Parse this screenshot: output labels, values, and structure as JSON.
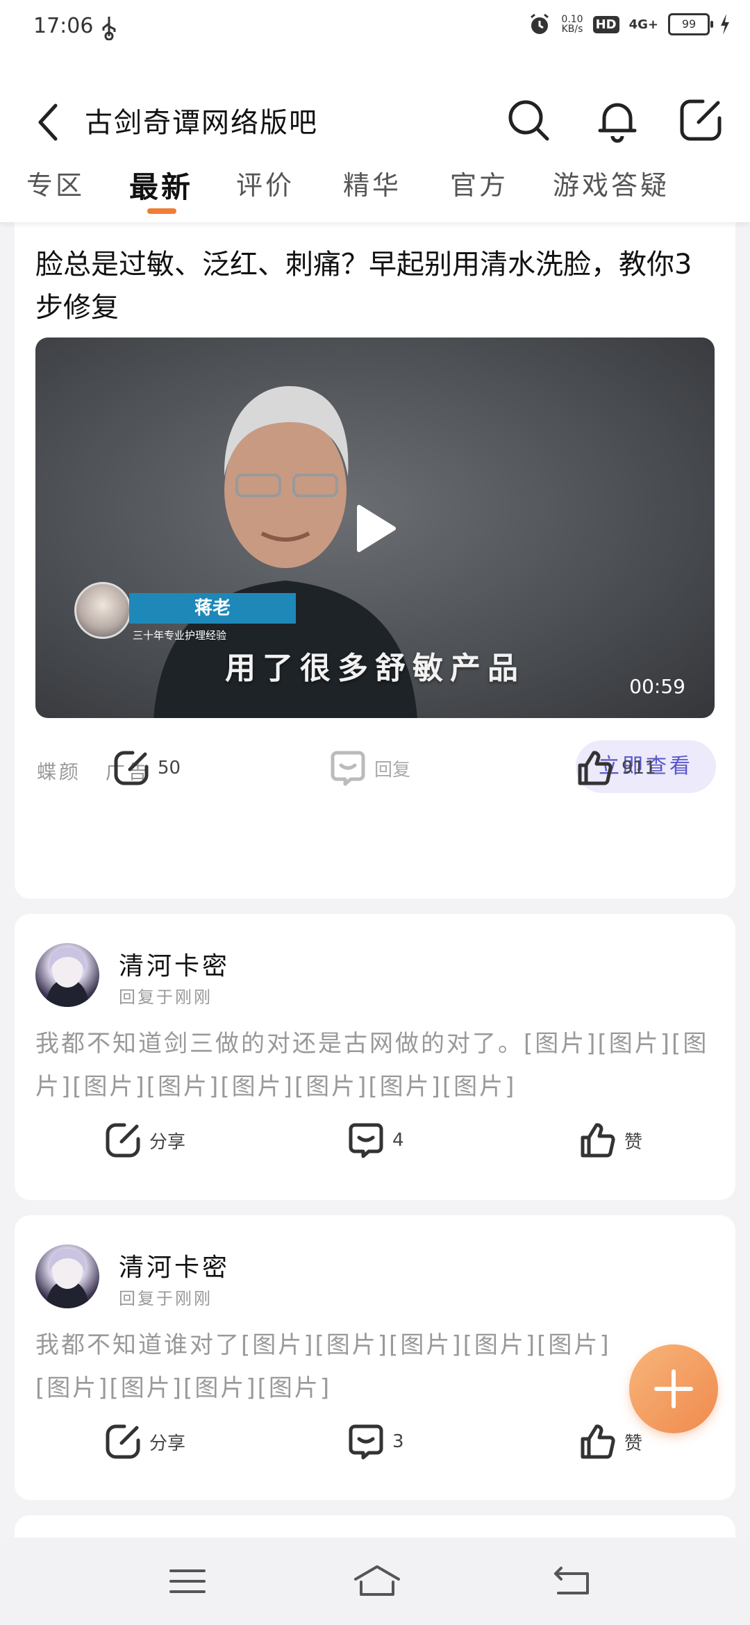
{
  "status_bar": {
    "time": "17:06",
    "network_speed_top": "0.10",
    "network_speed_bottom": "KB/s",
    "hd_badge": "HD",
    "signal": "4G+",
    "battery": "99"
  },
  "header": {
    "title": "古剑奇谭网络版吧",
    "tabs": [
      {
        "label": "专区"
      },
      {
        "label": "最新"
      },
      {
        "label": "评价"
      },
      {
        "label": "精华"
      },
      {
        "label": "官方"
      },
      {
        "label": "游戏答疑"
      }
    ],
    "active_tab": "最新",
    "accent_color": "#f07c35"
  },
  "ad_post": {
    "title": "脸总是过敏、泛红、刺痛？早起别用清水洗脸，教你3步修复",
    "video": {
      "name_tag": "蒋老",
      "name_sub": "三十年专业护理经验",
      "subtitle": "用了很多舒敏产品",
      "duration": "00:59"
    },
    "source": "蝶颜",
    "ad_label": "广告",
    "cta_label": "立即查看",
    "share_count": "50",
    "reply_label": "回复",
    "like_count": "911"
  },
  "posts": [
    {
      "username": "清河卡密",
      "time": "回复于刚刚",
      "text": "我都不知道剑三做的对还是古网做的对了。[图片][图片][图片][图片][图片][图片][图片][图片][图片]",
      "share_label": "分享",
      "comment_count": "4",
      "like_label": "赞"
    },
    {
      "username": "清河卡密",
      "time": "回复于刚刚",
      "text": "我都不知道谁对了[图片][图片][图片][图片][图片][图片][图片][图片][图片]",
      "share_label": "分享",
      "comment_count": "3",
      "like_label": "赞"
    }
  ],
  "icons": {
    "back": "back-arrow-icon",
    "search": "search-icon",
    "bell": "bell-icon",
    "compose": "compose-icon",
    "share": "share-icon",
    "comment": "comment-icon",
    "like": "thumbs-up-icon",
    "fab": "plus-icon",
    "nav_menu": "menu-icon",
    "nav_home": "home-icon",
    "nav_back": "return-icon"
  }
}
